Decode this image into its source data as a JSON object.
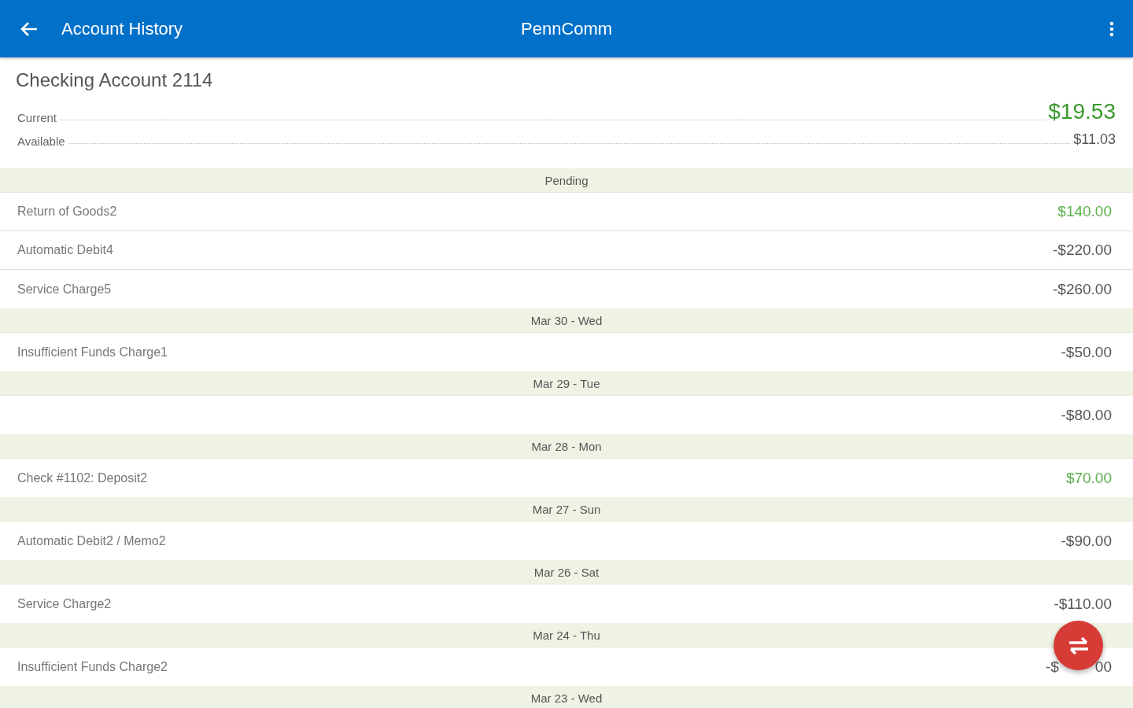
{
  "app_bar": {
    "title": "Account History",
    "app_name": "PennComm"
  },
  "account": {
    "name": "Checking Account 2114",
    "balances": [
      {
        "label": "Current",
        "amount": "$19.53",
        "kind": "primary"
      },
      {
        "label": "Available",
        "amount": "$11.03",
        "kind": "secondary"
      }
    ]
  },
  "sections": [
    {
      "heading": "Pending",
      "transactions": [
        {
          "description": "Return of Goods2",
          "amount": "$140.00",
          "credit": true
        },
        {
          "description": "Automatic Debit4",
          "amount": "-$220.00",
          "credit": false
        },
        {
          "description": "Service Charge5",
          "amount": "-$260.00",
          "credit": false
        }
      ]
    },
    {
      "heading": "Mar 30 - Wed",
      "transactions": [
        {
          "description": "Insufficient Funds Charge1",
          "amount": "-$50.00",
          "credit": false
        }
      ]
    },
    {
      "heading": "Mar 29 - Tue",
      "transactions": [
        {
          "amount": "-$80.00",
          "credit": false
        }
      ]
    },
    {
      "heading": "Mar 28 - Mon",
      "transactions": [
        {
          "description": "Check #1102: Deposit2",
          "amount": "$70.00",
          "credit": true
        }
      ]
    },
    {
      "heading": "Mar 27 - Sun",
      "transactions": [
        {
          "description": "Automatic Debit2 / Memo2",
          "amount": "-$90.00",
          "credit": false
        }
      ]
    },
    {
      "heading": "Mar 26 - Sat",
      "transactions": [
        {
          "description": "Service Charge2",
          "amount": "-$110.00",
          "credit": false
        }
      ]
    },
    {
      "heading": "Mar 24 - Thu",
      "transactions": [
        {
          "description": "Insufficient Funds Charge2",
          "amount_parts": [
            "-$",
            "00"
          ],
          "credit": false
        }
      ]
    },
    {
      "heading": "Mar 23 - Wed"
    }
  ],
  "fab": {
    "kind": "transfer"
  }
}
